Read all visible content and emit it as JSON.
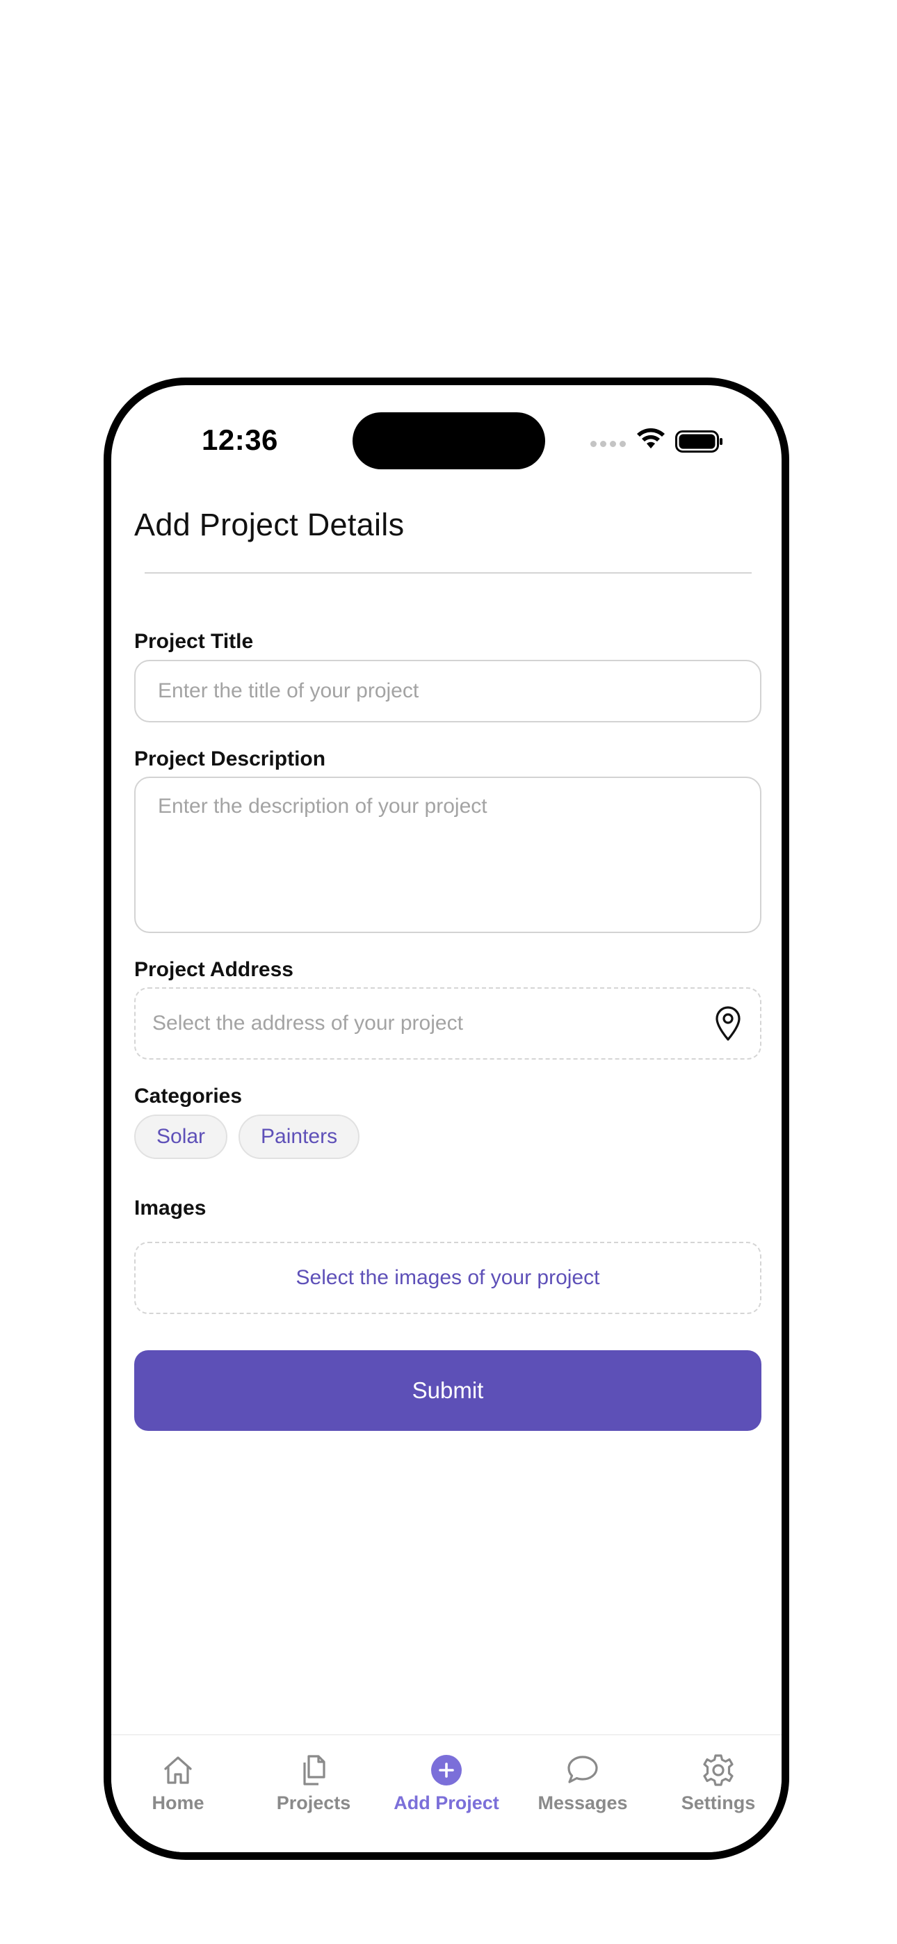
{
  "status_bar": {
    "time": "12:36"
  },
  "page": {
    "title": "Add Project Details"
  },
  "form": {
    "title_label": "Project Title",
    "title_placeholder": "Enter the title of your project",
    "title_value": "",
    "description_label": "Project Description",
    "description_placeholder": "Enter the description of your project",
    "description_value": "",
    "address_label": "Project Address",
    "address_placeholder": "Select the address of your project",
    "address_icon": "location-pin-icon",
    "categories_label": "Categories",
    "categories": [
      {
        "label": "Solar"
      },
      {
        "label": "Painters"
      }
    ],
    "images_label": "Images",
    "images_placeholder": "Select the images of your project",
    "submit_label": "Submit"
  },
  "tab_bar": {
    "active_index": 2,
    "items": [
      {
        "label": "Home",
        "icon": "home-icon"
      },
      {
        "label": "Projects",
        "icon": "documents-icon"
      },
      {
        "label": "Add Project",
        "icon": "plus-circle-icon"
      },
      {
        "label": "Messages",
        "icon": "chat-bubble-icon"
      },
      {
        "label": "Settings",
        "icon": "gear-icon"
      }
    ]
  },
  "colors": {
    "accent": "#5d50b7",
    "accent_light": "#7b6fd9",
    "chip_text": "#5e50b8",
    "placeholder": "#a3a3a3",
    "inactive_tab": "#8a8a8a"
  }
}
